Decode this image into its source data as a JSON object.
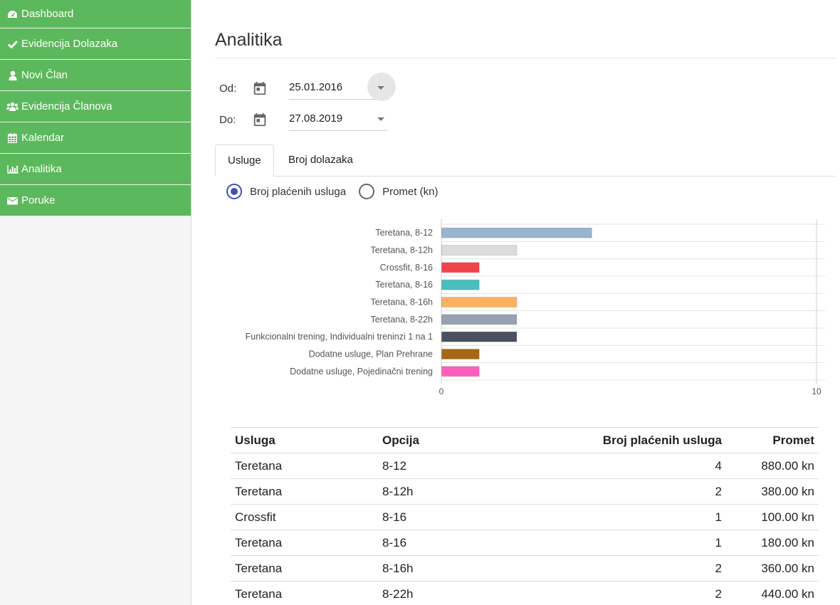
{
  "sidebar": {
    "items": [
      {
        "label": "Dashboard",
        "icon": "dashboard-icon"
      },
      {
        "label": "Evidencija Dolazaka",
        "icon": "check-icon"
      },
      {
        "label": "Novi Član",
        "icon": "user-icon"
      },
      {
        "label": "Evidencija Članova",
        "icon": "users-icon"
      },
      {
        "label": "Kalendar",
        "icon": "calendar-icon"
      },
      {
        "label": "Analitika",
        "icon": "bar-chart-icon"
      },
      {
        "label": "Poruke",
        "icon": "envelope-icon"
      }
    ]
  },
  "main": {
    "title": "Analitika",
    "from": {
      "label": "Od:",
      "value": "25.01.2016"
    },
    "to": {
      "label": "Do:",
      "value": "27.08.2019"
    },
    "tabs": [
      {
        "label": "Usluge",
        "active": true
      },
      {
        "label": "Broj dolazaka",
        "active": false
      }
    ],
    "radios": [
      {
        "label": "Broj plaćenih usluga",
        "checked": true
      },
      {
        "label": "Promet (kn)",
        "checked": false
      }
    ]
  },
  "chart_data": {
    "type": "bar",
    "orientation": "horizontal",
    "categories": [
      "Teretana, 8-12",
      "Teretana, 8-12h",
      "Crossfit, 8-16",
      "Teretana, 8-16",
      "Teretana, 8-16h",
      "Teretana, 8-22h",
      "Funkcionalni trening, Individualni treninzi 1 na 1",
      "Dodatne usluge, Plan Prehrane",
      "Dodatne usluge, Pojedinačni trening"
    ],
    "values": [
      4,
      2,
      1,
      1,
      2,
      2,
      2,
      1,
      1
    ],
    "colors": [
      "#97b5cc",
      "#dcdcdc",
      "#f1434b",
      "#4bbfbc",
      "#feb15f",
      "#97a0b4",
      "#4b4f5e",
      "#a46915",
      "#fe5fba"
    ],
    "xlim": [
      0,
      10
    ],
    "xticks": [
      "0",
      "10"
    ],
    "grid": true
  },
  "table": {
    "headers": [
      "Usluga",
      "Opcija",
      "Broj plaćenih usluga",
      "Promet"
    ],
    "rows": [
      [
        "Teretana",
        "8-12",
        "4",
        "880.00 kn"
      ],
      [
        "Teretana",
        "8-12h",
        "2",
        "380.00 kn"
      ],
      [
        "Crossfit",
        "8-16",
        "1",
        "100.00 kn"
      ],
      [
        "Teretana",
        "8-16",
        "1",
        "180.00 kn"
      ],
      [
        "Teretana",
        "8-16h",
        "2",
        "360.00 kn"
      ],
      [
        "Teretana",
        "8-22h",
        "2",
        "440.00 kn"
      ]
    ]
  }
}
